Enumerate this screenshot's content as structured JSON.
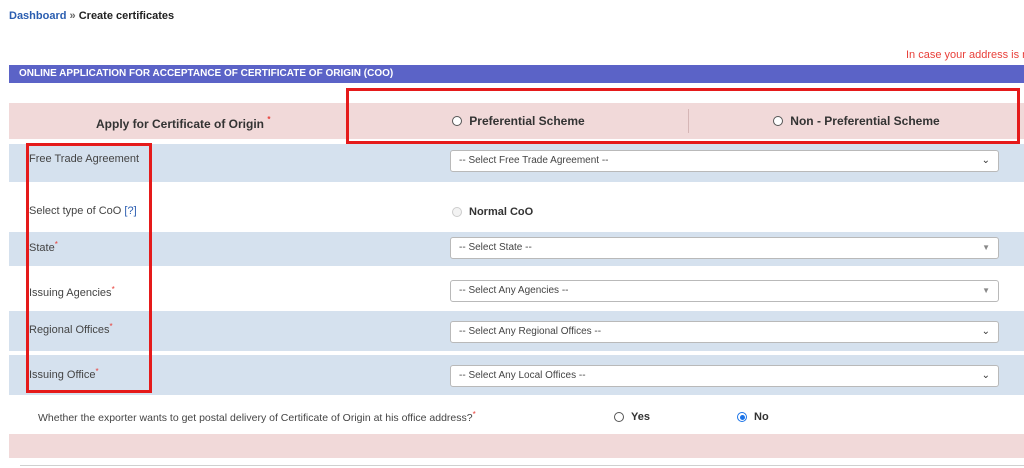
{
  "breadcrumb": {
    "home": "Dashboard",
    "separator": "»",
    "current": "Create certificates"
  },
  "notice": "In case your address is n",
  "form": {
    "header": "ONLINE APPLICATION FOR ACCEPTANCE OF CERTIFICATE OF ORIGIN (COO)",
    "apply_label": "Apply for Certificate of Origin",
    "schemes": {
      "preferential": "Preferential Scheme",
      "non_preferential": "Non - Preferential Scheme"
    },
    "fields": {
      "fta": {
        "label": "Free Trade Agreement",
        "placeholder": "-- Select Free Trade Agreement --"
      },
      "coo_type": {
        "label": "Select type of CoO",
        "help": "[?]",
        "option": "Normal CoO"
      },
      "state": {
        "label": "State",
        "placeholder": "-- Select State --"
      },
      "agencies": {
        "label": "Issuing Agencies",
        "placeholder": "-- Select Any Agencies --"
      },
      "regional": {
        "label": "Regional Offices",
        "placeholder": "-- Select Any Regional Offices --"
      },
      "office": {
        "label": "Issuing Office",
        "placeholder": "-- Select Any Local Offices --"
      }
    },
    "postal": {
      "question": "Whether the exporter wants to get postal delivery of Certificate of Origin at his office address?",
      "yes": "Yes",
      "no": "No",
      "selected": "No"
    },
    "required_mark": "*",
    "chevron_icon": "chevron-down-icon",
    "caret_icon": "caret-down-icon"
  },
  "colors": {
    "header_bg": "#5b63c7",
    "pink_row": "#f1d9d9",
    "blue_row": "#d5e1ee",
    "highlight": "#e51a1a",
    "link": "#2a5db0"
  }
}
